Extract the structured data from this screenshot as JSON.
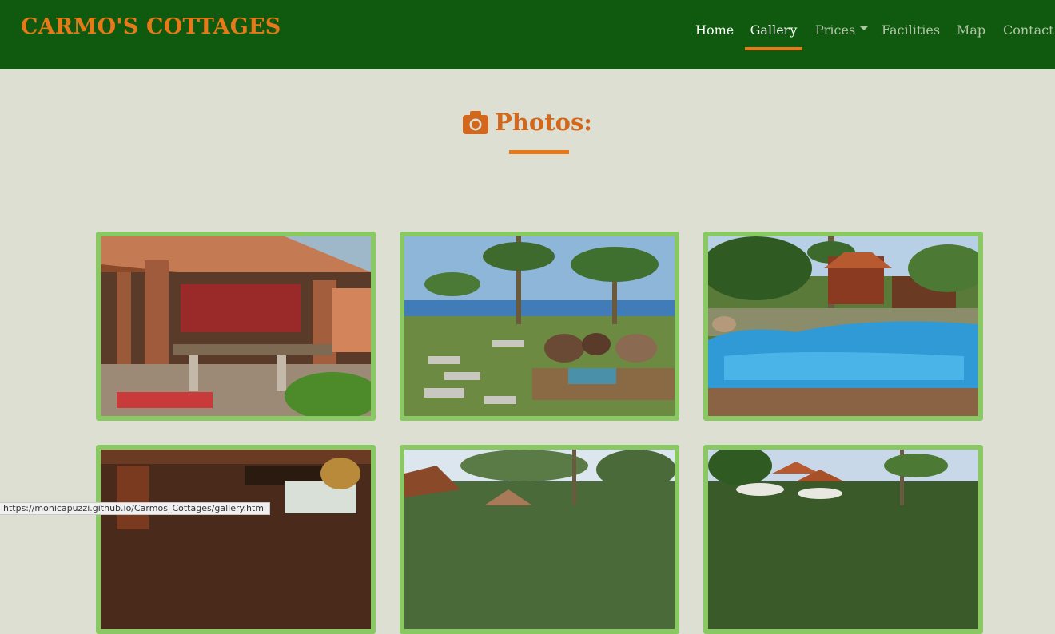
{
  "brand": "CARMO'S COTTAGES",
  "nav": {
    "home": "Home",
    "gallery": "Gallery",
    "prices": "Prices",
    "facilities": "Facilities",
    "map": "Map",
    "contact": "Contact"
  },
  "heading": "Photos:",
  "icons": {
    "heading": "camera-icon",
    "prices_dropdown": "caret-down-icon"
  },
  "colors": {
    "navbar": "#0f5a0e",
    "accent": "#e77918",
    "background": "#dedfd3",
    "thumb_border": "#8ac864"
  },
  "gallery": {
    "photos": [
      {
        "subject": "covered brick patio with wooden table"
      },
      {
        "subject": "stone path garden with palm trees and sea view"
      },
      {
        "subject": "swimming pool with cottages and palms"
      },
      {
        "subject": "interior of wooden building"
      },
      {
        "subject": "thatched cottages among palm trees"
      },
      {
        "subject": "cottages with umbrellas under palm trees"
      }
    ]
  },
  "status_url": "https://monicapuzzi.github.io/Carmos_Cottages/gallery.html"
}
